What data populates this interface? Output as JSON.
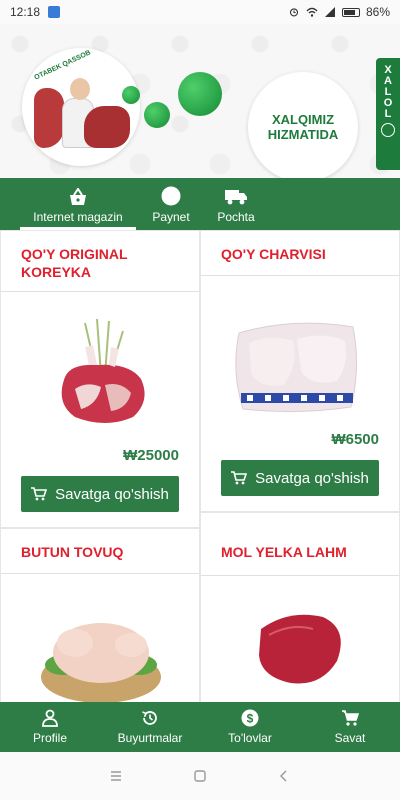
{
  "status_bar": {
    "time": "12:18",
    "battery": "86%"
  },
  "banner": {
    "logo_text": "OTABEK QASSOB",
    "slogan_line1": "XALQIMIZ",
    "slogan_line2": "HIZMATIDA",
    "badge_text": "XALOL"
  },
  "top_tabs": [
    {
      "label": "Internet magazin",
      "icon": "basket-icon",
      "active": true
    },
    {
      "label": "Paynet",
      "icon": "paynet-icon",
      "active": false
    },
    {
      "label": "Pochta",
      "icon": "truck-icon",
      "active": false
    }
  ],
  "products": [
    {
      "title": "QO'Y ORIGINAL KOREYKA",
      "price": "₩25000",
      "button": "Savatga qo'shish"
    },
    {
      "title": "QO'Y CHARVISI",
      "price": "₩6500",
      "button": "Savatga qo'shish"
    },
    {
      "title": "BUTUN TOVUQ"
    },
    {
      "title": "MOL YELKA LAHM"
    }
  ],
  "bottom_nav": [
    {
      "label": "Profile",
      "icon": "person-icon"
    },
    {
      "label": "Buyurtmalar",
      "icon": "history-icon"
    },
    {
      "label": "To'lovlar",
      "icon": "dollar-icon"
    },
    {
      "label": "Savat",
      "icon": "cart-icon"
    }
  ],
  "colors": {
    "brand_green": "#2e7d46",
    "title_red": "#e0202d"
  }
}
